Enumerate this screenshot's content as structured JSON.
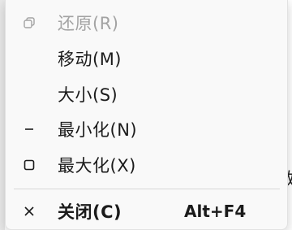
{
  "menu": {
    "items": [
      {
        "icon": "restore-icon",
        "label": "还原(R)",
        "enabled": false
      },
      {
        "icon": "",
        "label": "移动(M)",
        "enabled": true
      },
      {
        "icon": "",
        "label": "大小(S)",
        "enabled": true
      },
      {
        "icon": "minimize-icon",
        "label": "最小化(N)",
        "enabled": true
      },
      {
        "icon": "maximize-icon",
        "label": "最大化(X)",
        "enabled": true
      }
    ],
    "close": {
      "icon": "close-icon",
      "label": "关闭(C)",
      "shortcut": "Alt+F4"
    }
  },
  "backdrop": {
    "glyph": "数"
  },
  "colors": {
    "text": "#1b1b1b",
    "disabled_text": "#a3a3a3",
    "menu_bg": "#f9f9f9"
  }
}
